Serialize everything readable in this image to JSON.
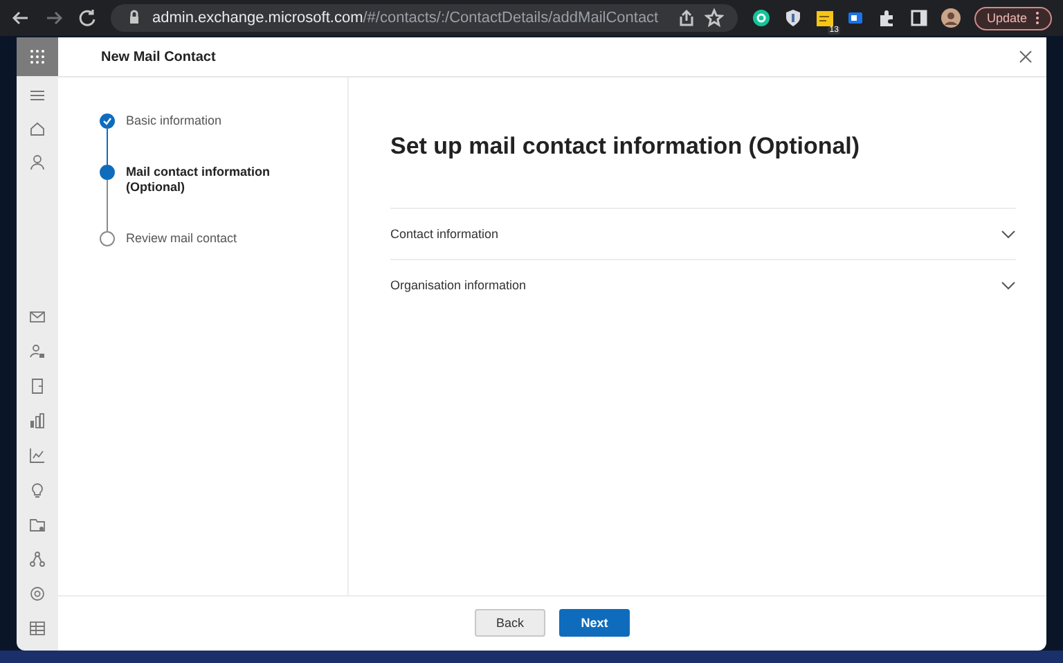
{
  "browser": {
    "url_host": "admin.exchange.microsoft.com",
    "url_path": "/#/contacts/:/ContactDetails/addMailContact",
    "extension_badge": "13",
    "update_label": "Update"
  },
  "panel": {
    "title": "New Mail Contact"
  },
  "steps": [
    {
      "label": "Basic information",
      "completed": true,
      "selected": false
    },
    {
      "label": "Mail contact information (Optional)",
      "completed": false,
      "selected": true
    },
    {
      "label": "Review mail contact",
      "completed": false,
      "selected": false
    }
  ],
  "heading": "Set up mail contact information (Optional)",
  "sections": [
    {
      "label": "Contact information",
      "expanded": false
    },
    {
      "label": "Organisation information",
      "expanded": false
    }
  ],
  "buttons": [
    {
      "label": "Back",
      "kind": "secondary"
    },
    {
      "label": "Next",
      "kind": "primary"
    }
  ]
}
